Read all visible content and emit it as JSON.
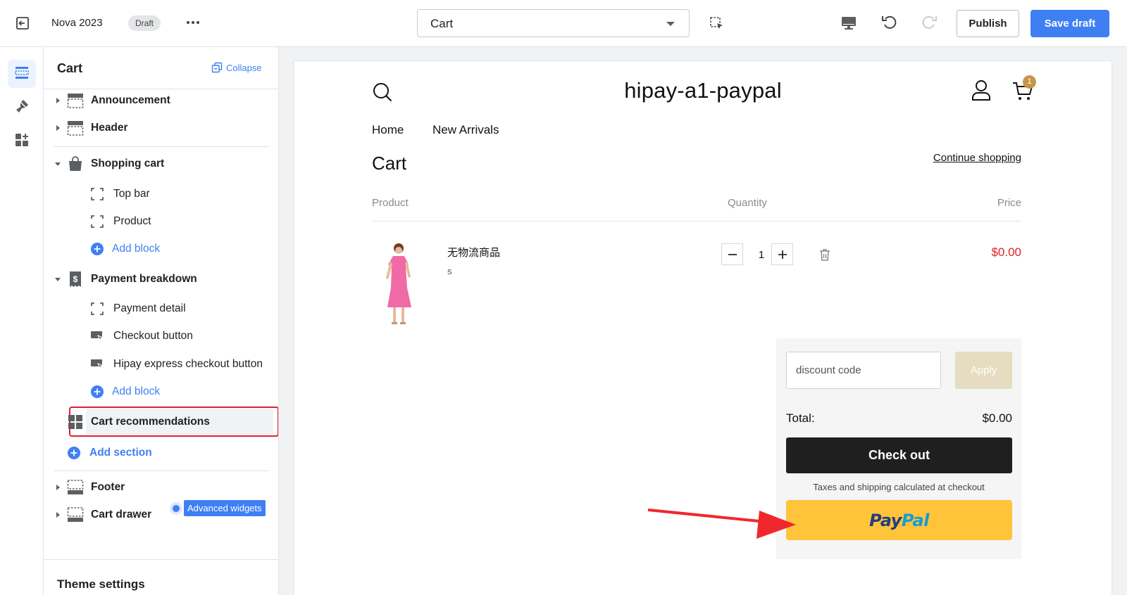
{
  "topbar": {
    "theme_name": "Nova 2023",
    "status_badge": "Draft",
    "page_select": "Cart",
    "publish_label": "Publish",
    "save_label": "Save draft"
  },
  "sidebar": {
    "title": "Cart",
    "collapse_label": "Collapse",
    "tree": {
      "announcement": "Announcement",
      "header": "Header",
      "shopping_cart": "Shopping cart",
      "top_bar": "Top bar",
      "product": "Product",
      "add_block_1": "Add block",
      "payment_breakdown": "Payment breakdown",
      "payment_detail": "Payment detail",
      "checkout_button": "Checkout button",
      "hipay_button": "Hipay express checkout button",
      "add_block_2": "Add block",
      "cart_recommendations": "Cart recommendations",
      "add_section": "Add section",
      "advanced_widgets": "Advanced widgets",
      "footer": "Footer",
      "cart_drawer": "Cart drawer"
    },
    "theme_settings": "Theme settings"
  },
  "store": {
    "title": "hipay-a1-paypal",
    "cart_count": "1",
    "nav": [
      "Home",
      "New Arrivals"
    ],
    "heading": "Cart",
    "continue": "Continue shopping",
    "columns": {
      "product": "Product",
      "quantity": "Quantity",
      "price": "Price"
    },
    "item": {
      "name": "无物流商品",
      "variant": "s",
      "qty": "1",
      "price": "$0.00"
    },
    "summary": {
      "discount_placeholder": "discount code",
      "apply": "Apply",
      "total_label": "Total:",
      "total_value": "$0.00",
      "checkout": "Check out",
      "tax_note": "Taxes and shipping calculated at checkout",
      "paypal_a": "Pay",
      "paypal_b": "Pal"
    }
  },
  "colors": {
    "accent": "#3f7ff4",
    "highlight": "#e02030",
    "paypal_bg": "#ffc439",
    "price": "#e02020"
  }
}
